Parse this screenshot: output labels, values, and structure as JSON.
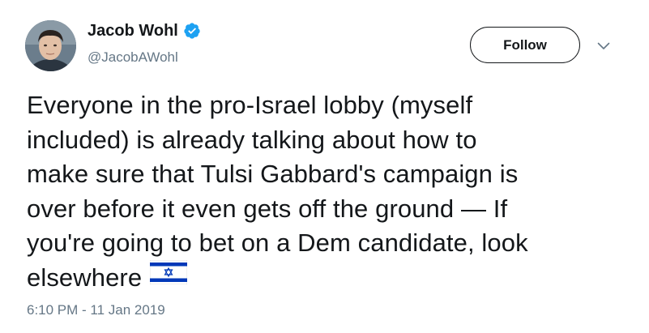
{
  "author": {
    "name": "Jacob Wohl",
    "handle": "@JacobAWohl",
    "verified": true
  },
  "actions": {
    "follow_label": "Follow",
    "more_icon": "chevron-down-icon"
  },
  "tweet": {
    "lines": [
      "Everyone in the pro-Israel lobby (myself",
      "included) is already talking about how to",
      "make sure that Tulsi Gabbard's campaign is",
      "over before it even gets off the ground — If",
      "you're going to bet on a Dem candidate, look",
      "elsewhere"
    ],
    "emoji": "israel-flag-icon",
    "timestamp": "6:10 PM - 11 Jan 2019"
  },
  "colors": {
    "text": "#14171a",
    "secondary": "#657786",
    "verified": "#1da1f2",
    "flag_blue": "#0038b8"
  }
}
